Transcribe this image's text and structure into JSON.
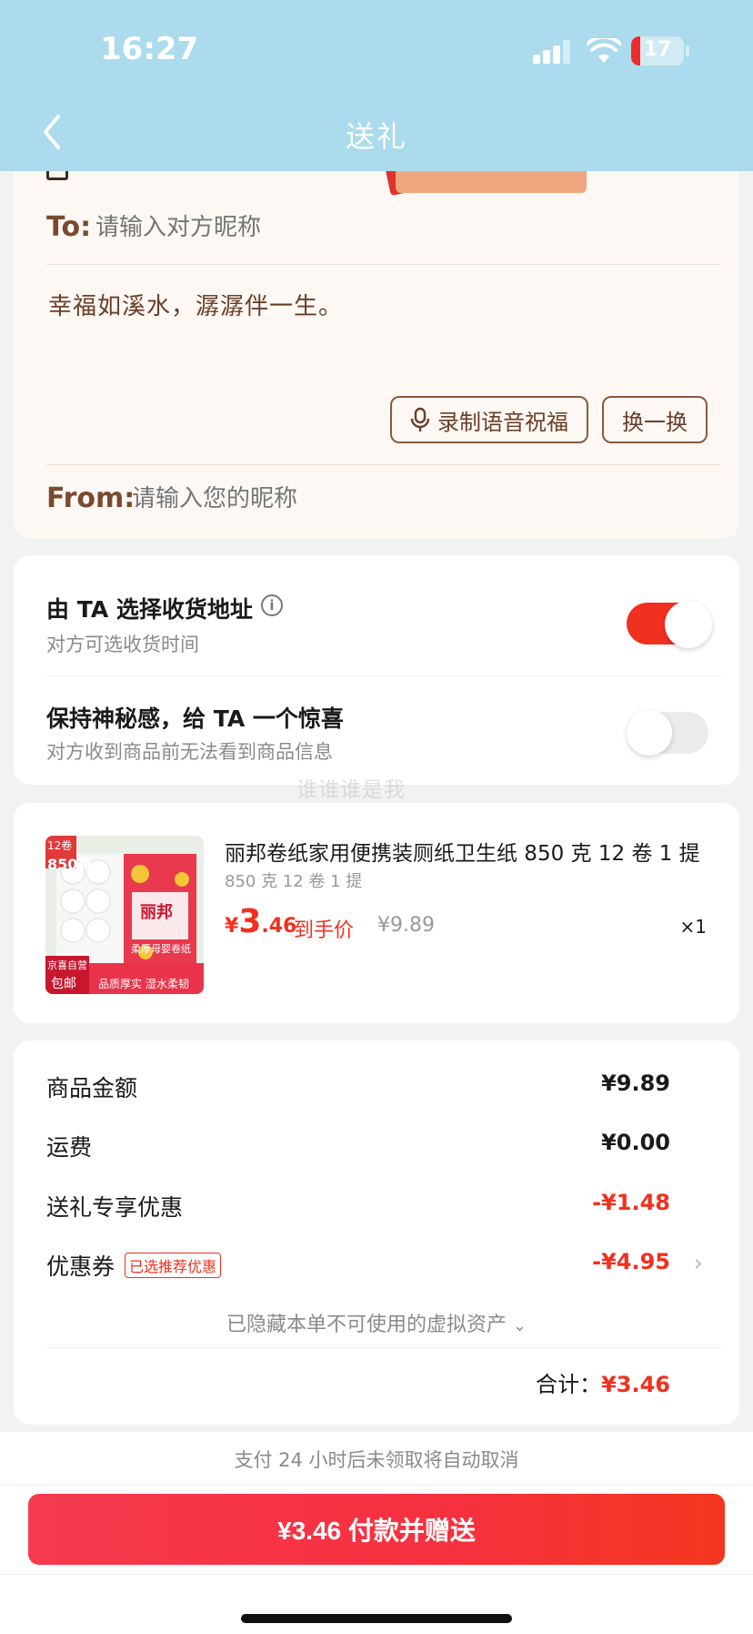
{
  "status_bar": {
    "time": "16:27",
    "battery": "17"
  },
  "nav": {
    "title": "送礼"
  },
  "gift_card": {
    "to_label": "To:",
    "to_placeholder": "请输入对方昵称",
    "blessing": "幸福如溪水，潺潺伴一生。",
    "record_voice_label": "录制语音祝福",
    "change_label": "换一换",
    "from_label": "From:",
    "from_placeholder": "请输入您的昵称"
  },
  "options": {
    "address": {
      "title": "由 TA 选择收货地址",
      "subtitle": "对方可选收货时间",
      "enabled": true
    },
    "mystery": {
      "title": "保持神秘感，给 TA 一个惊喜",
      "subtitle": "对方收到商品前无法看到商品信息",
      "enabled": false
    }
  },
  "watermark": "谁谁谁是我",
  "product": {
    "title": "丽邦卷纸家用便携装厕纸卫生纸 850 克 12 卷 1 提",
    "spec": "850 克 12 卷 1 提",
    "price_symbol": "¥",
    "price_int": "3",
    "price_dec": ".46",
    "price_label": "到手价",
    "original_price": "¥9.89",
    "quantity": "×1",
    "image_badge_top": "12卷",
    "image_badge_weight": "850克",
    "image_badge_jd": "京喜自营",
    "image_badge_free": "包邮",
    "image_brand": "丽邦",
    "image_caption1": "柔厚母婴卷纸",
    "image_caption2": "品质厚实 湿水柔韧"
  },
  "summary": {
    "rows": [
      {
        "label": "商品金额",
        "value": "¥9.89"
      },
      {
        "label": "运费",
        "value": "¥0.00"
      },
      {
        "label": "送礼专享优惠",
        "value": "-¥1.48"
      },
      {
        "label": "优惠券",
        "value": "-¥4.95"
      }
    ],
    "coupon_tag": "已选推荐优惠",
    "hidden_assets": "已隐藏本单不可使用的虚拟资产",
    "total_label": "合计：",
    "total_value": "¥3.46"
  },
  "bottom": {
    "notice": "支付 24 小时后未领取将自动取消",
    "pay_button": "¥3.46 付款并赠送"
  },
  "colors": {
    "accent": "#f2301f",
    "header_bg": "#abdbec",
    "card_warm": "#fdf8f4"
  }
}
